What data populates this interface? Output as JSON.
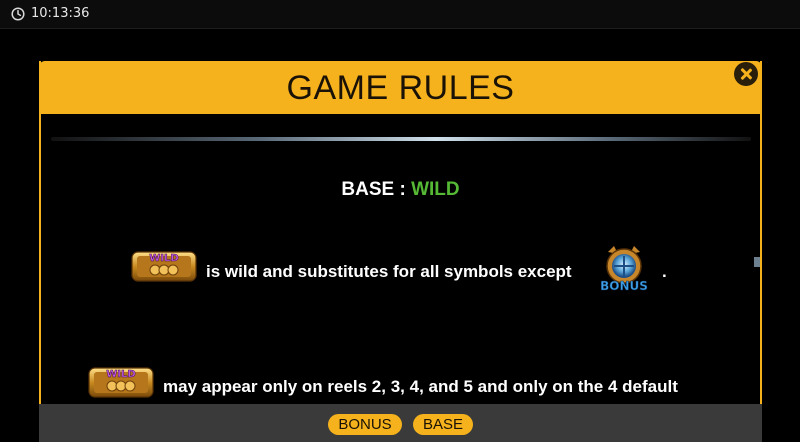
{
  "status_bar": {
    "time": "10:13:36"
  },
  "dialog": {
    "title": "GAME RULES",
    "close_icon": "close-icon"
  },
  "section": {
    "heading_prefix": "BASE : ",
    "heading_highlight": "WILD",
    "highlight_color": "#55b935"
  },
  "rules": [
    {
      "text": "is wild and substitutes for all symbols except",
      "suffix": "."
    },
    {
      "text": "may appear only on reels 2, 3, 4, and 5 and only on the 4 default"
    }
  ],
  "symbols": {
    "wild_label": "WILD",
    "bonus_label": "BONUS"
  },
  "tabs": [
    {
      "label": "BONUS"
    },
    {
      "label": "BASE"
    }
  ],
  "colors": {
    "accent": "#f5b21c",
    "tab_bar": "#3a3a3a"
  }
}
